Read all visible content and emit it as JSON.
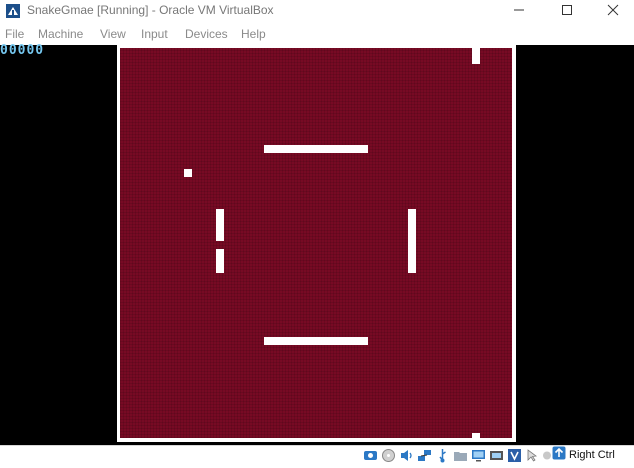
{
  "window": {
    "title": "SnakeGmae [Running] - Oracle VM VirtualBox"
  },
  "menu": {
    "items": [
      "File",
      "Machine",
      "View",
      "Input",
      "Devices",
      "Help"
    ]
  },
  "game": {
    "score": "00000",
    "score_color": "#76c8f0",
    "arena_color": "#770a24",
    "wall_color": "#ffffff"
  },
  "statusbar": {
    "host_key_label": "Right Ctrl",
    "icons": [
      "hard-disk-icon",
      "optical-drive-icon",
      "audio-icon",
      "network-icon",
      "usb-icon",
      "shared-folders-icon",
      "display-icon",
      "recording-icon",
      "virtualization-icon",
      "mouse-integration-icon",
      "host-key-arrow-icon"
    ]
  }
}
